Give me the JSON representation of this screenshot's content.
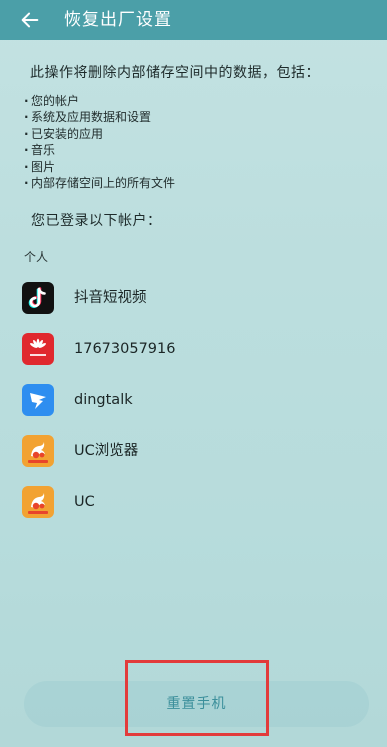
{
  "header": {
    "title": "恢复出厂设置",
    "back_icon": "arrow-left-icon",
    "background": "#4b9fa8"
  },
  "intro": "此操作将删除内部储存空间中的数据，包括：",
  "data_items": [
    "您的帐户",
    "系统及应用数据和设置",
    "已安装的应用",
    "音乐",
    "图片",
    "内部存储空间上的所有文件"
  ],
  "accounts_heading": "您已登录以下帐户：",
  "section_label": "个人",
  "accounts": [
    {
      "name": "抖音短视频",
      "icon": "douyin-icon"
    },
    {
      "name": "17673057916",
      "icon": "huawei-icon"
    },
    {
      "name": "dingtalk",
      "icon": "dingtalk-icon"
    },
    {
      "name": "UC浏览器",
      "icon": "uc-browser-icon"
    },
    {
      "name": "UC",
      "icon": "uc-icon"
    }
  ],
  "reset_button": {
    "label": "重置手机",
    "text_color": "#3c8f9b"
  },
  "colors": {
    "background": "#bcdede",
    "highlight": "#e23b3b"
  }
}
